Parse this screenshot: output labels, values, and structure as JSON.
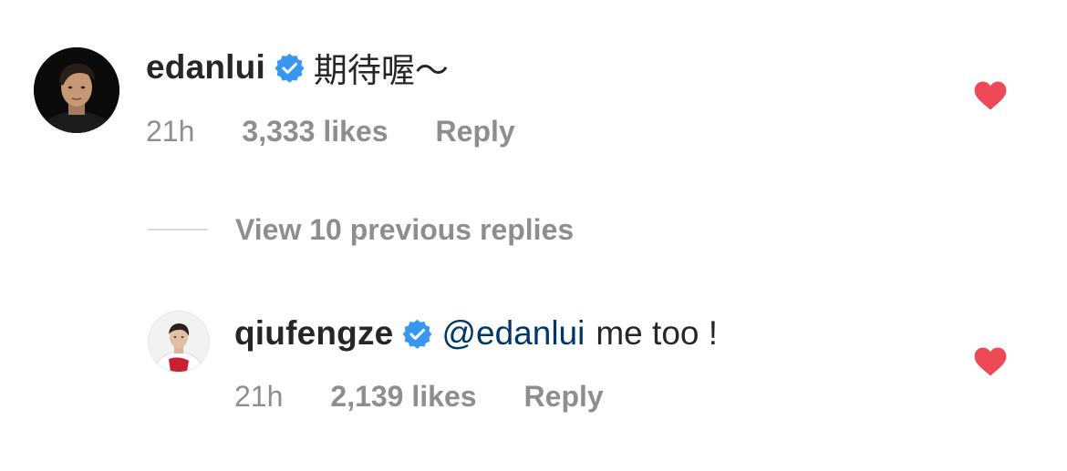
{
  "colors": {
    "text": "#262626",
    "secondary": "#8e8e8e",
    "mention": "#00376b",
    "verified": "#3897f0",
    "heart": "#ed4956"
  },
  "comments": [
    {
      "username": "edanlui",
      "verified": true,
      "text": "期待喔～",
      "time": "21h",
      "likes": "3,333 likes",
      "reply_label": "Reply",
      "liked": true,
      "avatar_icon": "profile-photo"
    }
  ],
  "view_replies_label": "View 10 previous replies",
  "replies": [
    {
      "username": "qiufengze",
      "verified": true,
      "mention": "@edanlui",
      "text": "me too !",
      "time": "21h",
      "likes": "2,139 likes",
      "reply_label": "Reply",
      "liked": true,
      "avatar_icon": "profile-photo"
    }
  ]
}
